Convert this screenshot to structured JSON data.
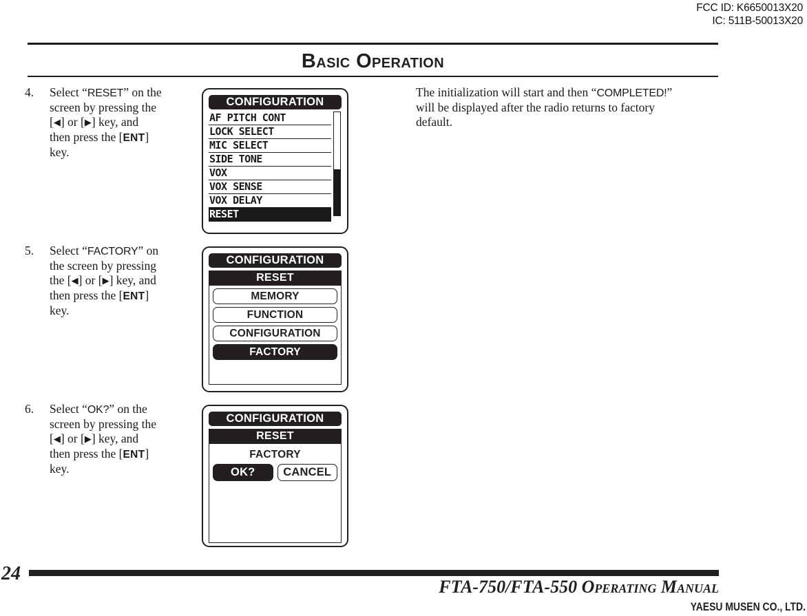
{
  "regulatory": {
    "fcc_id": "FCC ID: K6650013X20",
    "ic_id": "IC: 511B-50013X20"
  },
  "header": {
    "title": "Basic Operation"
  },
  "steps": [
    {
      "number": "4.",
      "line1": "Select “RESET” on the",
      "line2": "screen by pressing the",
      "line3_pre": "[",
      "line3_left": "◀",
      "line3_mid": "] or [",
      "line3_right": "▶",
      "line3_post": "] key, and",
      "line4_pre": "then press the [",
      "line4_key": "ENT",
      "line4_post": "]",
      "line5": "key.",
      "term": "RESET"
    },
    {
      "number": "5.",
      "line1": "Select “FACTORY” on",
      "line2": "the screen by pressing",
      "line3_pre": "the [",
      "line3_left": "◀",
      "line3_mid": "] or [",
      "line3_right": "▶",
      "line3_post": "] key, and",
      "line4_pre": "then press the [",
      "line4_key": "ENT",
      "line4_post": "]",
      "line5": "key.",
      "term": "FACTORY"
    },
    {
      "number": "6.",
      "line1": "Select “OK?” on the",
      "line2": "screen by pressing the",
      "line3_pre": "[",
      "line3_left": "◀",
      "line3_mid": "] or [",
      "line3_right": "▶",
      "line3_post": "] key, and",
      "line4_pre": "then press the [",
      "line4_key": "ENT",
      "line4_post": "]",
      "line5": "key.",
      "term": "OK?"
    }
  ],
  "right_column": {
    "line1_pre": "The initialization will start and then “",
    "line1_term": "COMPLETED!",
    "line1_post": "”",
    "line2": "will be displayed after the radio returns to factory",
    "line3": "default."
  },
  "lcd1": {
    "title": "CONFIGURATION",
    "rows": [
      {
        "label": "AF PITCH CONT",
        "selected": false
      },
      {
        "label": "LOCK SELECT",
        "selected": false
      },
      {
        "label": "MIC SELECT",
        "selected": false
      },
      {
        "label": "SIDE TONE",
        "selected": false
      },
      {
        "label": "VOX",
        "selected": false
      },
      {
        "label": "VOX SENSE",
        "selected": false
      },
      {
        "label": "VOX DELAY",
        "selected": false
      },
      {
        "label": "RESET",
        "selected": true
      }
    ],
    "scroll_thumb_position": "bottom"
  },
  "lcd2": {
    "title": "CONFIGURATION",
    "subtitle": "RESET",
    "options": [
      {
        "label": "MEMORY",
        "selected": false
      },
      {
        "label": "FUNCTION",
        "selected": false
      },
      {
        "label": "CONFIGURATION",
        "selected": false
      },
      {
        "label": "FACTORY",
        "selected": true
      }
    ]
  },
  "lcd3": {
    "title": "CONFIGURATION",
    "subtitle": "RESET",
    "mode_label": "FACTORY",
    "confirm": [
      {
        "label": "OK?",
        "selected": true
      },
      {
        "label": "CANCEL",
        "selected": false
      }
    ]
  },
  "footer": {
    "page_number": "24",
    "manual_title": "FTA-750/FTA-550 Operating Manual",
    "company": "YAESU MUSEN CO., LTD."
  }
}
